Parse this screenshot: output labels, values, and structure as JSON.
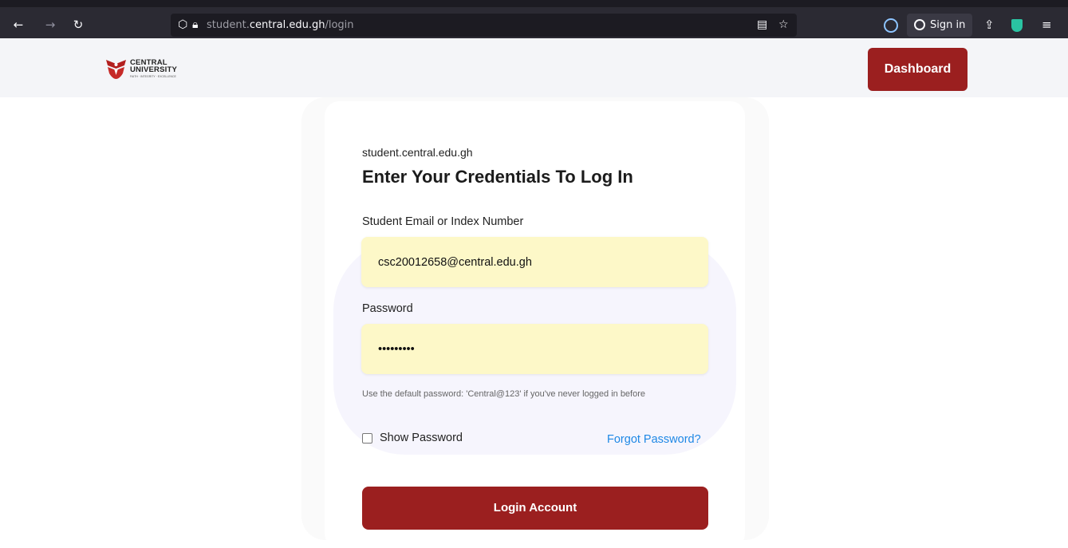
{
  "browser": {
    "back_icon": "arrow-left-icon",
    "forward_icon": "arrow-right-icon",
    "reload_icon": "reload-icon",
    "url_prefix": "student.",
    "url_host": "central.edu.gh",
    "url_path": "/login",
    "signin_label": "Sign in",
    "menu_icon": "hamburger-icon"
  },
  "header": {
    "logo_line1": "CENTRAL",
    "logo_line2": "UNIVERSITY",
    "logo_tagline": "FAITH · INTEGRITY · EXCELLENCE",
    "dashboard_label": "Dashboard",
    "accent": "#9b1f1f"
  },
  "login": {
    "site_name": "student.central.edu.gh",
    "title": "Enter Your Credentials To Log In",
    "email_label": "Student Email or Index Number",
    "email_value": "csc20012658@central.edu.gh",
    "password_label": "Password",
    "password_value": "•••••••••",
    "hint": "Use the default password: 'Central@123' if you've never logged in before",
    "show_password_label": "Show Password",
    "forgot_label": "Forgot Password?",
    "submit_label": "Login Account",
    "input_bg": "#fdf8c8",
    "link_color": "#1e88e5"
  }
}
